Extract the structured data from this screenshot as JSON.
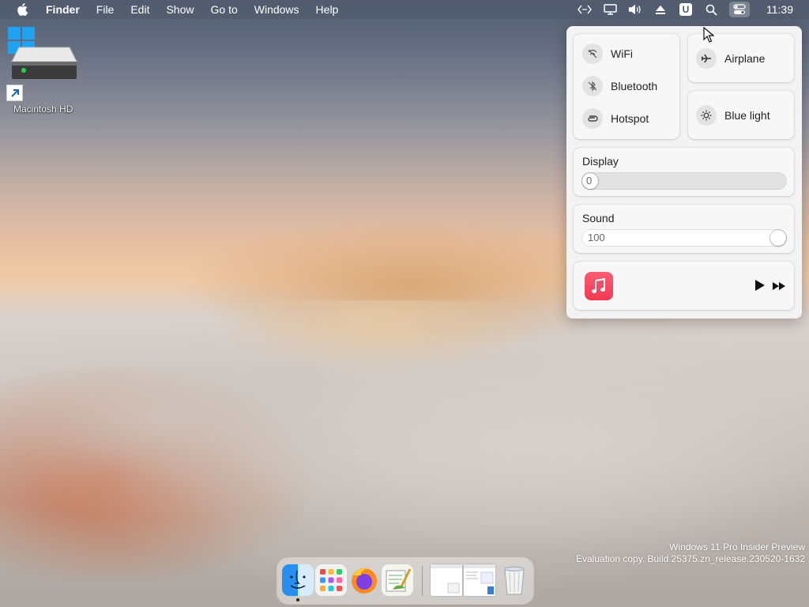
{
  "menubar": {
    "app_name": "Finder",
    "menus": [
      "File",
      "Edit",
      "Show",
      "Go to",
      "Windows",
      "Help"
    ],
    "status_icons": [
      "code-icon",
      "display-icon",
      "volume-icon",
      "eject-icon",
      "u-icon",
      "search-icon",
      "control-center-icon"
    ],
    "u_label": "U",
    "clock": "11:39"
  },
  "desktop": {
    "drive_label": "Macintosh HD"
  },
  "control_center": {
    "connectivity": {
      "wifi_label": "WiFi",
      "bluetooth_label": "Bluetooth",
      "hotspot_label": "Hotspot"
    },
    "airplane_label": "Airplane",
    "bluelight_label": "Blue light",
    "display": {
      "title": "Display",
      "value": "0"
    },
    "sound": {
      "title": "Sound",
      "value": "100"
    },
    "music": {
      "app_icon": "music-app-icon"
    }
  },
  "dock": {
    "apps": [
      "finder-icon",
      "launchpad-icon",
      "firefox-icon",
      "text-editor-icon",
      "window-thumbnail-icon",
      "window-thumbnail-icon",
      "trash-icon"
    ]
  },
  "watermark": {
    "line1": "Windows 11 Pro Insider Preview",
    "line2": "Evaluation copy. Build 25375.zn_release.230520-1632"
  },
  "colors": {
    "menubar_bg": "#525c6e",
    "panel_bg": "#f3f3f3",
    "music_red": "#f23a52",
    "windows_blue": "#1fa2f2"
  }
}
